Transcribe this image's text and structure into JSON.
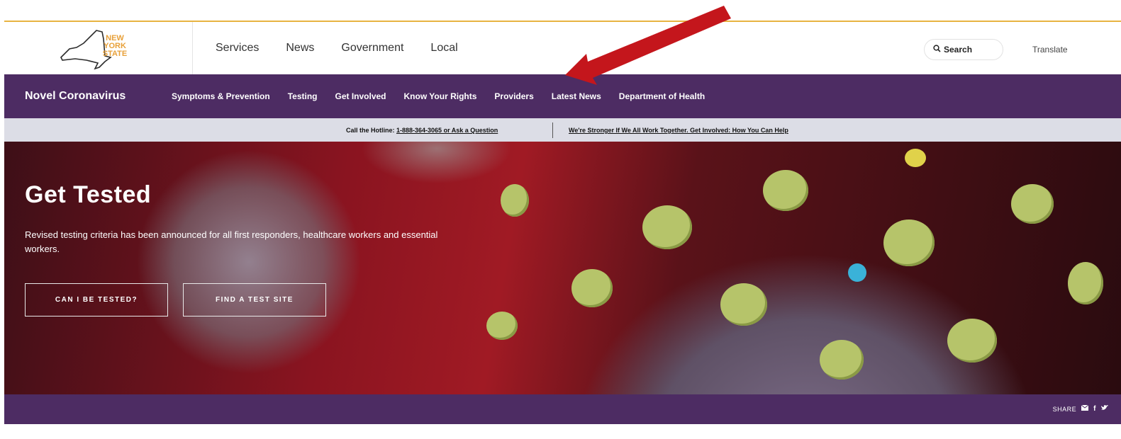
{
  "header": {
    "logo_text": [
      "NEW",
      "YORK",
      "STATE"
    ],
    "nav": [
      "Services",
      "News",
      "Government",
      "Local"
    ],
    "search_label": "Search",
    "translate_label": "Translate"
  },
  "covid_nav": {
    "brand": "Novel Coronavirus",
    "links": [
      "Symptoms & Prevention",
      "Testing",
      "Get Involved",
      "Know Your Rights",
      "Providers",
      "Latest News",
      "Department of Health"
    ]
  },
  "hotline_bar": {
    "left_prefix": "Call the Hotline: ",
    "left_link": "1-888-364-3065 or Ask a Question",
    "right_link": "We're Stronger If We All Work Together. Get Involved: How You Can Help"
  },
  "hero": {
    "title": "Get Tested",
    "description": "Revised testing criteria has been announced for all first responders, healthcare workers and essential workers.",
    "buttons": [
      "CAN I BE TESTED?",
      "FIND A TEST SITE"
    ]
  },
  "share": {
    "label": "SHARE",
    "icons": [
      "email-icon",
      "facebook-icon",
      "twitter-icon"
    ]
  },
  "colors": {
    "purple": "#4d2c63",
    "gold": "#e8b341",
    "arrow": "#c4161c",
    "hotline_bg": "#dcdde6"
  }
}
